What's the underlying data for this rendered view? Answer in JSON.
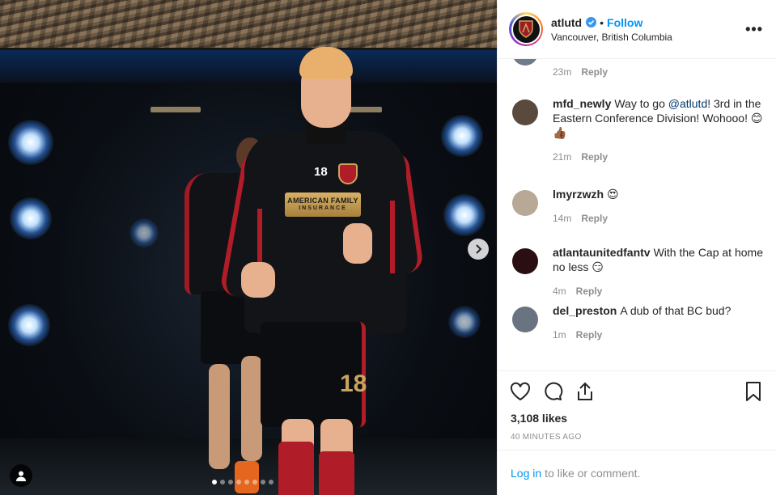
{
  "post": {
    "username": "atlutd",
    "follow_label": "Follow",
    "separator": "•",
    "location": "Vancouver, British Columbia",
    "more_label": "•••"
  },
  "photo": {
    "jersey_number": "18",
    "sponsor_line1": "AMERICAN FAMILY",
    "sponsor_line2": "INSURANCE",
    "shorts_number": "18",
    "carousel_dots": 8,
    "active_dot": 0
  },
  "top_comment_meta": {
    "time": "23m",
    "reply": "Reply"
  },
  "comments": [
    {
      "user": "mfd_newly",
      "pre": "Way to go ",
      "mention": "@atlutd",
      "post": "! 3rd in the Eastern Conference Division! Wohooo! 😊 👍🏾",
      "time": "21m",
      "reply": "Reply",
      "avatar_color": "#5a4a3e"
    },
    {
      "user": "lmyrzwzh",
      "pre": "😍",
      "mention": "",
      "post": "",
      "time": "14m",
      "reply": "Reply",
      "avatar_color": "#b8a896"
    },
    {
      "user": "atlantaunitedfantv",
      "pre": "With the Cap at home no less 😏",
      "mention": "",
      "post": "",
      "time": "4m",
      "reply": "Reply",
      "avatar_color": "#2a0e12"
    },
    {
      "user": "del_preston",
      "pre": "A dub of that BC bud?",
      "mention": "",
      "post": "",
      "time": "1m",
      "reply": "Reply",
      "avatar_color": "#6a7480"
    }
  ],
  "likes": "3,108 likes",
  "timestamp": "40 MINUTES AGO",
  "login": {
    "link": "Log in",
    "text": "to like or comment."
  },
  "colors": {
    "accent": "#0095f6",
    "verified": "#3897f0",
    "club_red": "#b01c28",
    "club_gold": "#c9a45c"
  }
}
